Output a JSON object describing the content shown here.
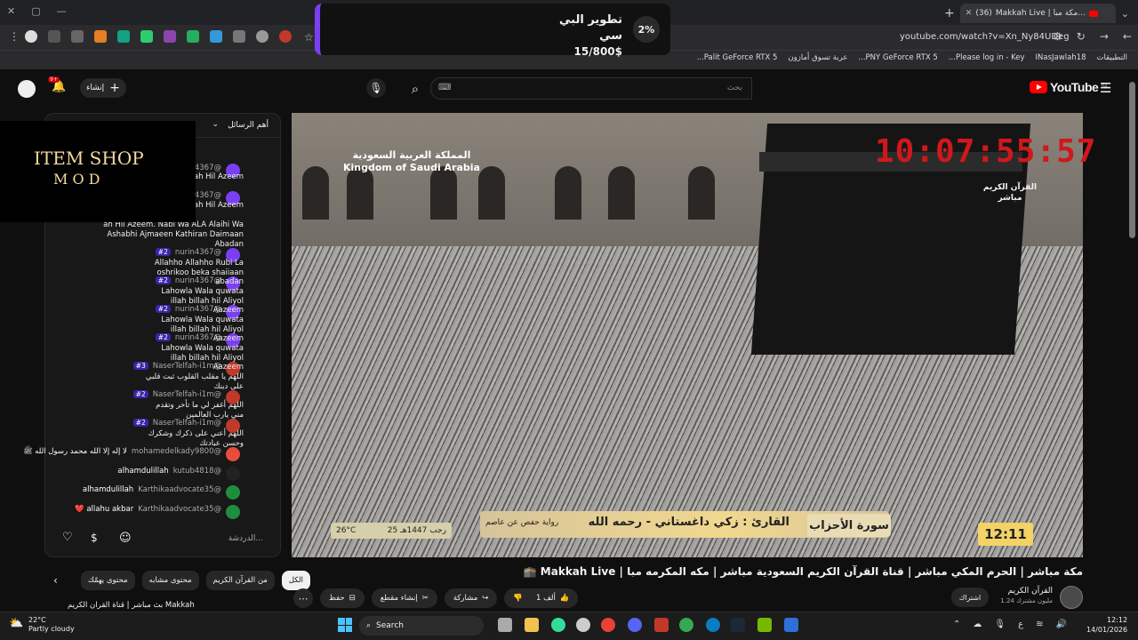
{
  "browser": {
    "tab_title": "Makkah Live | مكة مبا...",
    "tab_count": "(36)",
    "url": "youtube.com/watch?v=Xn_Ny84UDeg",
    "bookmarks": [
      "التطبيقات",
      "INasJawlah18",
      "Please log in - Key...",
      "PNY GeForce RTX 5...",
      "عربة تسوق أمازون",
      "Palit GeForce RTX 5..."
    ]
  },
  "promo": {
    "title": "تطوير البي سي",
    "amount": "15/800$",
    "percent": "2%"
  },
  "youtube": {
    "logo": "YouTube",
    "logo_region": "SA",
    "search_placeholder": "بحث",
    "search_hint": "⌨",
    "create_label": "إنشاء",
    "notif_count": "9+"
  },
  "chat": {
    "header": "أهم الرسائل",
    "input_placeholder": "الدردشة...",
    "overlay": {
      "line1": "ITEM SHOP",
      "line2": "M O D"
    },
    "messages": [
      {
        "user": "@nurin4367",
        "text": "ah Hil Azeem",
        "color": "#7b3ff2"
      },
      {
        "user": "@nurin4367",
        "text": "ah Hil Azeem",
        "color": "#7b3ff2"
      },
      {
        "user": "@nurin4367",
        "text": "ah Hil Azeem. Nabi Wa ALA Alaihi Wa Ashabhi Ajmaeen Kathiran Daimaan Abadan",
        "color": "#7b3ff2"
      },
      {
        "user": "@nurin4367",
        "badge": "#2",
        "text": "Allahho Allahho Rubi La oshrikoo beka shaiiaan abadan",
        "color": "#7b3ff2"
      },
      {
        "user": "@nurin4367",
        "badge": "#2",
        "text": "Lahowla Wala quwata illah billah hil Aliyol Aazeem",
        "color": "#7b3ff2"
      },
      {
        "user": "@nurin4367",
        "badge": "#2",
        "text": "Lahowla Wala quwata illah billah hil Aliyol Aazeem",
        "color": "#7b3ff2"
      },
      {
        "user": "@nurin4367",
        "badge": "#2",
        "text": "Lahowla Wala quwata illah billah hil Aliyol Aazeem",
        "color": "#7b3ff2"
      },
      {
        "user": "@NaserTelfah-i1m",
        "badge": "#3",
        "text": "اللهم يا مقلب القلوب ثبت قلبي على دينك",
        "color": "#c0392b"
      },
      {
        "user": "@NaserTelfah-i1m",
        "badge": "#2",
        "text": "اللهم أغفر لي ما تأخر وتقدم مني يارب العالمين",
        "color": "#c0392b"
      },
      {
        "user": "@NaserTelfah-i1m",
        "badge": "#2",
        "text": "اللهم أعني على ذكرك وشكرك وحسن عبادتك",
        "color": "#c0392b"
      },
      {
        "user": "@mohamedelkady9800",
        "text": "لا إله إلا الله محمد رسول الله ﷺ",
        "color": "#e74c3c"
      },
      {
        "user": "@kutub4818",
        "text": "alhamdulillah",
        "color": "#111111"
      },
      {
        "user": "@Karthikaadvocate35",
        "text": "alhamdulillah",
        "color": "#1e8e3e"
      },
      {
        "user": "@Karthikaadvocate35",
        "text": "allahu akbar ❤️",
        "color": "#1e8e3e"
      }
    ]
  },
  "video": {
    "clock": "10:07:55:57",
    "channel_logo_text": "القرآن الكريم مباشر",
    "ksa_arabic": "المملكة العربية السعودية",
    "ksa_english": "Kingdom of Saudi Arabia",
    "surah": "سورة الأحزاب",
    "reciter": "القارئ : زكي داغستاني - رحمه الله",
    "narration": "رواية حفص عن عاصم",
    "hijri_date": "25 رجب 1447هـ",
    "temperature": "26°C",
    "time": "12:11"
  },
  "meta": {
    "title": "مكة مباشر | الحرم المكي مباشر | قناة القرآن الكريم السعودية مباشر | مكه المكرمه مبا | Makkah Live 🕋",
    "channel": "القرآن الكريم",
    "subscribers": "1.24 مليون مشترك",
    "subscribe": "اشتراك",
    "actions": {
      "like": "1 ألف",
      "share": "مشاركة",
      "clip": "إنشاء مقطع",
      "save": "حفظ"
    },
    "chips": [
      "الكل",
      "من القرآن الكريم",
      "محتوى مشابه",
      "محتوى يهمّك"
    ]
  },
  "up_next": {
    "title": "بث مباشر | قناة القرآن الكريم Makkah"
  },
  "taskbar": {
    "search": "Search",
    "weather_temp": "22°C",
    "weather_desc": "Partly cloudy",
    "time": "12:12",
    "date": "14/01/2026",
    "lang": "ع"
  }
}
